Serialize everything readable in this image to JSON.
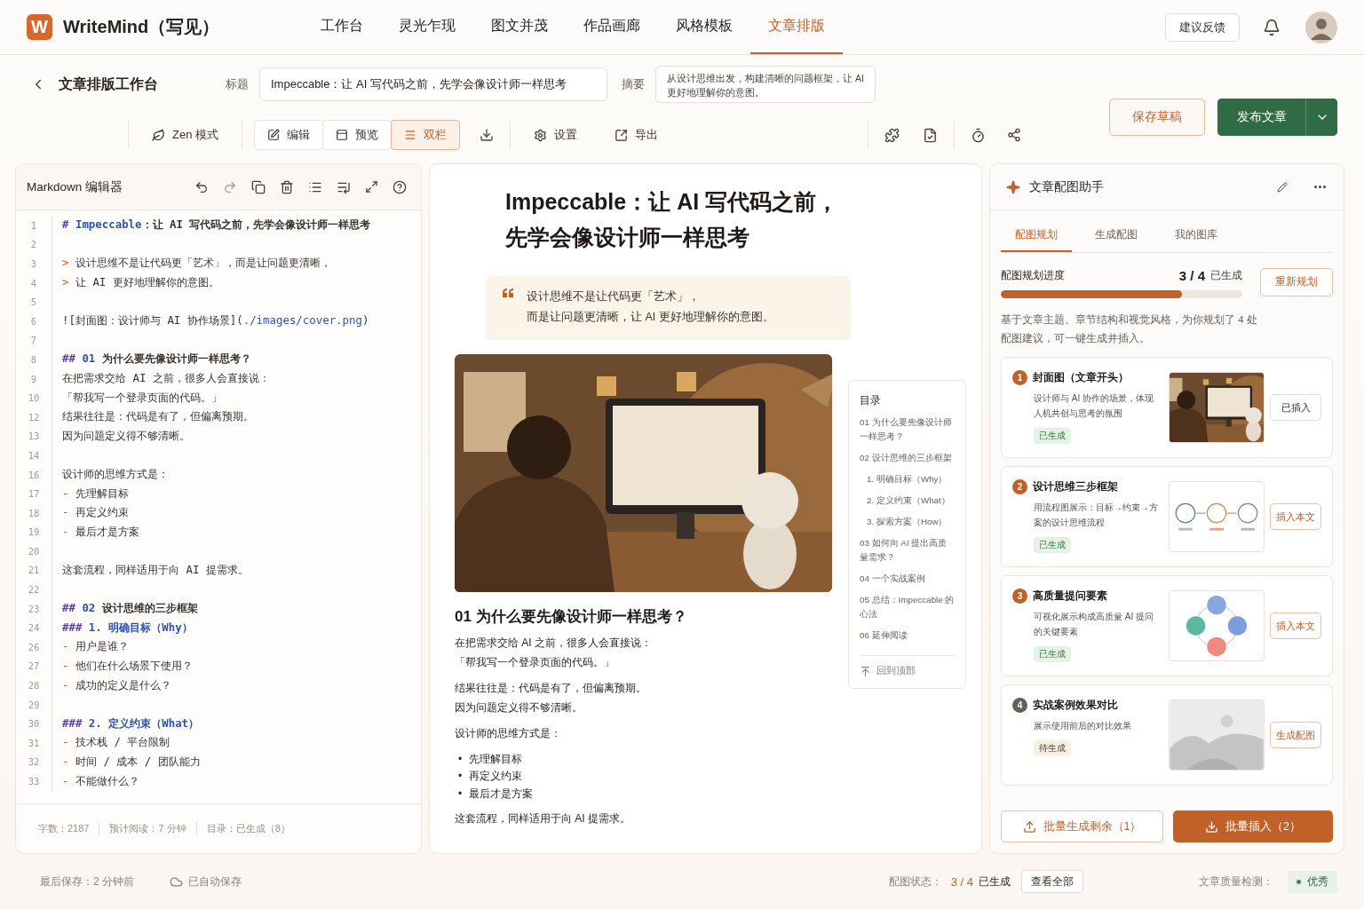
{
  "app": {
    "logo": "W",
    "name": "WriteMind（写见）"
  },
  "nav": [
    {
      "label": "工作台",
      "selected": false
    },
    {
      "label": "灵光乍现",
      "selected": false
    },
    {
      "label": "图文并茂",
      "selected": false
    },
    {
      "label": "作品画廊",
      "selected": false
    },
    {
      "label": "风格模板",
      "selected": false
    },
    {
      "label": "文章排版",
      "selected": true
    }
  ],
  "feedback": "建议反馈",
  "page": {
    "title": "文章排版工作台",
    "title_label": "标题",
    "title_value": "Impeccable：让 AI 写代码之前，先学会像设计师一样思考",
    "summary_label": "摘要",
    "summary_value": "从设计思维出发，构建清晰的问题框架，让 AI 更好地理解你的意图。",
    "save": "保存草稿",
    "publish": "发布文章"
  },
  "toolbar": {
    "zen": "Zen 模式",
    "views": [
      {
        "label": "编辑",
        "selected": false
      },
      {
        "label": "预览",
        "selected": false
      },
      {
        "label": "双栏",
        "selected": true
      }
    ],
    "settings": "设置",
    "export": "导出"
  },
  "editor": {
    "title": "Markdown 编辑器",
    "lines": [
      {
        "num": "1",
        "kind": "h1",
        "parts": [
          {
            "kind": "mark",
            "text": "# "
          },
          {
            "kind": "accent",
            "text": "Impeccable"
          },
          {
            "kind": "plain",
            "text": "：让 AI 写代码之前，先学会像设计师一样思考"
          }
        ]
      },
      {
        "num": "2",
        "kind": "blank"
      },
      {
        "num": "3",
        "kind": "quote",
        "parts": [
          {
            "kind": "bullet",
            "text": "> "
          },
          {
            "kind": "plain",
            "text": "设计思维不是让代码更「艺术」，而是让问题更清晰，"
          }
        ]
      },
      {
        "num": "4",
        "kind": "quote",
        "parts": [
          {
            "kind": "bullet",
            "text": "> "
          },
          {
            "kind": "plain",
            "text": "让 AI 更好地理解你的意图。"
          }
        ]
      },
      {
        "num": "5",
        "kind": "blank"
      },
      {
        "num": "6",
        "parts": [
          {
            "kind": "plain",
            "text": "![封面图：设计师与 AI 协作场景]("
          },
          {
            "kind": "link",
            "text": "./images/cover.png"
          },
          {
            "kind": "plain",
            "text": ")"
          }
        ]
      },
      {
        "num": "7",
        "kind": "blank"
      },
      {
        "num": "8",
        "kind": "h2",
        "parts": [
          {
            "kind": "mark",
            "text": "## "
          },
          {
            "kind": "accent",
            "text": "01 "
          },
          {
            "kind": "plain",
            "text": "为什么要先像设计师一样思考？"
          }
        ]
      },
      {
        "num": "9",
        "kind": "text",
        "parts": [
          {
            "kind": "plain",
            "text": "在把需求交给 AI 之前，很多人会直接说："
          }
        ]
      },
      {
        "num": "10",
        "kind": "text",
        "parts": [
          {
            "kind": "plain",
            "text": "「帮我写一个登录页面的代码。」"
          }
        ]
      },
      {
        "num": "12",
        "kind": "text",
        "parts": [
          {
            "kind": "plain",
            "text": "结果往往是：代码是有了，但偏离预期。"
          }
        ]
      },
      {
        "num": "13",
        "kind": "text",
        "parts": [
          {
            "kind": "plain",
            "text": "因为问题定义得不够清晰。"
          }
        ]
      },
      {
        "num": "14",
        "kind": "blank"
      },
      {
        "num": "16",
        "kind": "text",
        "parts": [
          {
            "kind": "plain",
            "text": "设计师的思维方式是："
          }
        ]
      },
      {
        "num": "17",
        "kind": "list",
        "parts": [
          {
            "kind": "bullet",
            "text": "- "
          },
          {
            "kind": "plain",
            "text": "先理解目标"
          }
        ]
      },
      {
        "num": "18",
        "kind": "list",
        "parts": [
          {
            "kind": "bullet",
            "text": "- "
          },
          {
            "kind": "plain",
            "text": "再定义约束"
          }
        ]
      },
      {
        "num": "19",
        "kind": "list",
        "parts": [
          {
            "kind": "bullet",
            "text": "- "
          },
          {
            "kind": "plain",
            "text": "最后才是方案"
          }
        ]
      },
      {
        "num": "20",
        "kind": "blank"
      },
      {
        "num": "21",
        "kind": "text",
        "parts": [
          {
            "kind": "plain",
            "text": "这套流程，同样适用于向 AI 提需求。"
          }
        ]
      },
      {
        "num": "22",
        "kind": "blank"
      },
      {
        "num": "23",
        "kind": "h2",
        "parts": [
          {
            "kind": "mark",
            "text": "## "
          },
          {
            "kind": "accent",
            "text": "02 "
          },
          {
            "kind": "plain",
            "text": "设计思维的三步框架"
          }
        ]
      },
      {
        "num": "24",
        "kind": "h3",
        "parts": [
          {
            "kind": "mark",
            "text": "### "
          },
          {
            "kind": "accent",
            "text": "1. 明确目标（Why）"
          }
        ]
      },
      {
        "num": "26",
        "kind": "list",
        "parts": [
          {
            "kind": "bullet",
            "text": "- "
          },
          {
            "kind": "plain",
            "text": "用户是谁？"
          }
        ]
      },
      {
        "num": "27",
        "kind": "list",
        "parts": [
          {
            "kind": "bullet",
            "text": "- "
          },
          {
            "kind": "plain",
            "text": "他们在什么场景下使用？"
          }
        ]
      },
      {
        "num": "28",
        "kind": "list",
        "parts": [
          {
            "kind": "bullet",
            "text": "- "
          },
          {
            "kind": "plain",
            "text": "成功的定义是什么？"
          }
        ]
      },
      {
        "num": "29",
        "kind": "blank"
      },
      {
        "num": "30",
        "kind": "h3",
        "parts": [
          {
            "kind": "mark",
            "text": "### "
          },
          {
            "kind": "accent",
            "text": "2. 定义约束（What）"
          }
        ]
      },
      {
        "num": "31",
        "kind": "list",
        "parts": [
          {
            "kind": "bullet",
            "text": "- "
          },
          {
            "kind": "plain",
            "text": "技术栈 / 平台限制"
          }
        ]
      },
      {
        "num": "32",
        "kind": "list",
        "parts": [
          {
            "kind": "bullet",
            "text": "- "
          },
          {
            "kind": "plain",
            "text": "时间 / 成本 / 团队能力"
          }
        ]
      },
      {
        "num": "33",
        "kind": "list",
        "parts": [
          {
            "kind": "bullet",
            "text": "- "
          },
          {
            "kind": "plain",
            "text": "不能做什么？"
          }
        ]
      }
    ],
    "stats": [
      "字数：2187",
      "预计阅读：7 分钟",
      "目录：已生成（8）"
    ]
  },
  "preview": {
    "title_lines": [
      "Impeccable：让 AI 写代码之前，",
      "先学会像设计师一样思考"
    ],
    "quote_lines": [
      "设计思维不是让代码更「艺术」，",
      "而是让问题更清晰，让 AI 更好地理解你的意图。"
    ],
    "section_title": "01 为什么要先像设计师一样思考？",
    "blocks": [
      {
        "kind": "para",
        "lines": [
          "在把需求交给 AI 之前，很多人会直接说：",
          "「帮我写一个登录页面的代码。」"
        ]
      },
      {
        "kind": "para",
        "lines": [
          "结果往往是：代码是有了，但偏离预期。",
          "因为问题定义得不够清晰。"
        ]
      },
      {
        "kind": "para",
        "lines": [
          "设计师的思维方式是："
        ]
      },
      {
        "kind": "bullets",
        "marker": "•",
        "lines": [
          "先理解目标",
          "再定义约束",
          "最后才是方案"
        ]
      },
      {
        "kind": "para",
        "lines": [
          "这套流程，同样适用于向 AI 提需求。"
        ]
      }
    ],
    "toc": {
      "title": "目录",
      "items": [
        {
          "label": "01 为什么要先像设计师一样思考？"
        },
        {
          "label": "02 设计思维的三步框架",
          "children": [
            {
              "label": "1. 明确目标（Why）"
            },
            {
              "label": "2. 定义约束（What）"
            },
            {
              "label": "3. 探索方案（How）"
            }
          ]
        },
        {
          "label": "03 如何向 AI 提出高质量需求？"
        },
        {
          "label": "04 一个实战案例"
        },
        {
          "label": "05 总结：Impeccable 的心法"
        },
        {
          "label": "06 延伸阅读"
        }
      ],
      "back_to_top": "回到顶部"
    }
  },
  "assistant": {
    "title": "文章配图助手",
    "tabs": [
      {
        "label": "配图规划",
        "selected": true
      },
      {
        "label": "生成配图",
        "selected": false
      },
      {
        "label": "我的图库",
        "selected": false
      }
    ],
    "progress": {
      "label": "配图规划进度",
      "count": "3 / 4",
      "status": "已生成",
      "level": 0.75,
      "action": "重新规划"
    },
    "description": "基于文章主题、章节结构和视觉风格，为你规划了 4 处配图建议，可一键生成并插入。",
    "cards": [
      {
        "num": "1",
        "title": "封面图（文章开头）",
        "desc": "设计师与 AI 协作的场景，体现人机共创与思考的氛围",
        "status": "已生成",
        "generated": true,
        "action": "已插入",
        "action_highlighted": false
      },
      {
        "num": "2",
        "title": "设计思维三步框架",
        "desc": "用流程图展示：目标→约束→方案的设计思维流程",
        "status": "已生成",
        "generated": true,
        "thumbnail": {
          "kind": "flow"
        },
        "action": "插入本文",
        "action_highlighted": true
      },
      {
        "num": "3",
        "title": "高质量提问要素",
        "desc": "可视化展示构成高质量 AI 提问的关键要素",
        "status": "已生成",
        "generated": true,
        "thumbnail": {
          "kind": "cycle"
        },
        "action": "插入本文",
        "action_highlighted": true
      },
      {
        "num": "4",
        "title": "实战案例效果对比",
        "desc": "展示使用前后的对比效果",
        "status": "待生成",
        "generated": false,
        "thumbnail": {
          "kind": "placeholder"
        },
        "action": "生成配图",
        "action_highlighted": true
      }
    ],
    "batch_generate": "批量生成剩余（1）",
    "batch_insert": "批量插入（2）"
  },
  "status": {
    "last_saved": "最后保存：2 分钟前",
    "autosave": "已自动保存",
    "image_label": "配图状态：",
    "image_count": "3 / 4",
    "image_text": "已生成",
    "view_all": "查看全部",
    "quality_label": "文章质量检测：",
    "quality": {
      "label": "优秀",
      "color": "#3f8a52"
    }
  }
}
